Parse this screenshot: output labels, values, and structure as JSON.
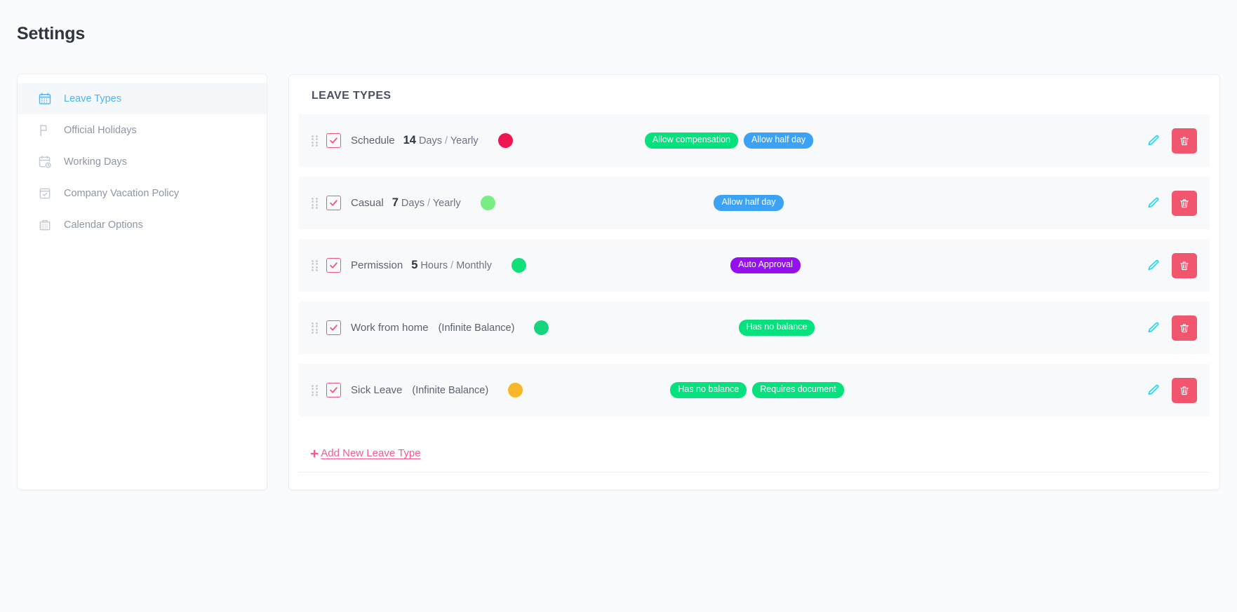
{
  "page": {
    "title": "Settings"
  },
  "sidebar": {
    "items": [
      {
        "label": "Leave Types",
        "icon": "calendar-grid-icon",
        "active": true
      },
      {
        "label": "Official Holidays",
        "icon": "flag-icon",
        "active": false
      },
      {
        "label": "Working Days",
        "icon": "calendar-clock-icon",
        "active": false
      },
      {
        "label": "Company Vacation Policy",
        "icon": "calendar-check-icon",
        "active": false
      },
      {
        "label": "Calendar Options",
        "icon": "clipboard-calendar-icon",
        "active": false
      }
    ]
  },
  "main": {
    "heading": "LEAVE TYPES",
    "add_new": {
      "plus": "+",
      "label": "Add New Leave Type"
    },
    "rows": [
      {
        "name": "Schedule",
        "amount": "14",
        "unit": "Days",
        "separator": "/",
        "period": "Yearly",
        "infinite": "",
        "dot_color": "#ef1550",
        "badges": [
          {
            "label": "Allow compensation",
            "color": "green"
          },
          {
            "label": "Allow half day",
            "color": "blue"
          }
        ],
        "badges_offset": "-36px"
      },
      {
        "name": "Casual",
        "amount": "7",
        "unit": "Days",
        "separator": "/",
        "period": "Yearly",
        "infinite": "",
        "dot_color": "#76ee82",
        "badges": [
          {
            "label": "Allow half day",
            "color": "blue"
          }
        ],
        "badges_offset": "-8px"
      },
      {
        "name": "Permission",
        "amount": "5",
        "unit": "Hours",
        "separator": "/",
        "period": "Monthly",
        "infinite": "",
        "dot_color": "#10e078",
        "badges": [
          {
            "label": "Auto Approval",
            "color": "purple"
          }
        ],
        "badges_offset": "16px"
      },
      {
        "name": "Work from home",
        "amount": "",
        "unit": "",
        "separator": "",
        "period": "",
        "infinite": "(Infinite Balance)",
        "dot_color": "#15d67e",
        "badges": [
          {
            "label": "Has no balance",
            "color": "green"
          }
        ],
        "badges_offset": "32px"
      },
      {
        "name": "Sick Leave",
        "amount": "",
        "unit": "",
        "separator": "",
        "period": "",
        "infinite": "(Infinite Balance)",
        "dot_color": "#f8b62a",
        "badges": [
          {
            "label": "Has no balance",
            "color": "green"
          },
          {
            "label": "Requires document",
            "color": "green"
          }
        ],
        "badges_offset": "4px"
      }
    ],
    "row_actions": {
      "edit": "pencil-icon",
      "delete": "trash-icon"
    }
  },
  "colors": {
    "accent_blue": "#4eb3f5",
    "accent_pink": "#fb5a8e",
    "badge_green": "#05e17c",
    "badge_blue": "#3ba2f5",
    "badge_purple": "#9410ee",
    "delete_button": "#f2566e",
    "edit_icon": "#1fd8f0"
  }
}
